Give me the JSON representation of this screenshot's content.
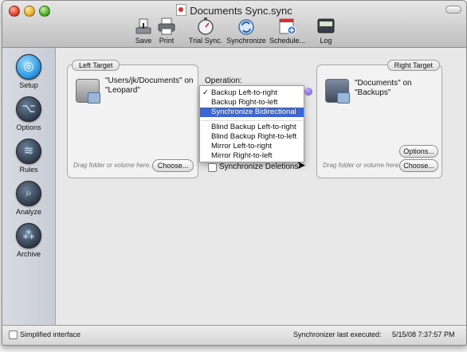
{
  "window": {
    "title": "Documents Sync.sync"
  },
  "toolbar": {
    "save": "Save",
    "print": "Print",
    "trial_sync": "Trial Sync.",
    "synchronize": "Synchronize",
    "schedule": "Schedule...",
    "log": "Log"
  },
  "sidebar": {
    "items": [
      {
        "label": "Setup",
        "icon": "setup-icon",
        "active": true
      },
      {
        "label": "Options",
        "icon": "options-icon"
      },
      {
        "label": "Rules",
        "icon": "rules-icon"
      },
      {
        "label": "Analyze",
        "icon": "analyze-icon"
      },
      {
        "label": "Archive",
        "icon": "archive-icon"
      }
    ]
  },
  "left_target": {
    "label": "Left Target",
    "path_text": "\"Users/jk/Documents\" on \"Leopard\"",
    "drag_hint": "Drag folder or volume here...",
    "choose": "Choose..."
  },
  "right_target": {
    "label": "Right Target",
    "path_text": "\"Documents\" on \"Backups\"",
    "drag_hint": "Drag folder or volume here...",
    "options": "Options...",
    "choose": "Choose..."
  },
  "operation": {
    "label": "Operation:",
    "options": [
      "Backup Left-to-right",
      "Backup Right-to-left",
      "Synchronize Bidirectional",
      "Blind Backup Left-to-right",
      "Blind Backup Right-to-left",
      "Mirror Left-to-right",
      "Mirror Right-to-left"
    ],
    "checked": "Backup Left-to-right",
    "highlighted": "Synchronize Bidirectional",
    "synchronize_deletions": "Synchronize Deletions"
  },
  "status": {
    "simplified": "Simplified interface",
    "last_executed": "Synchronizer last executed:",
    "timestamp": "5/15/08 7:37:57 PM"
  },
  "colors": {
    "highlight": "#3a66d8",
    "accent": "#2f9be3"
  }
}
